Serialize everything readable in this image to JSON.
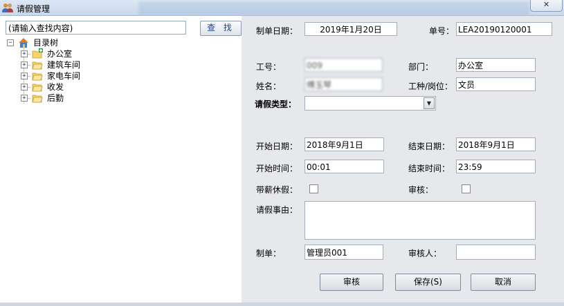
{
  "window": {
    "title": "请假管理",
    "close_label": "✕"
  },
  "search": {
    "value": "(请输入查找内容)",
    "button_label": "查 找"
  },
  "tree": {
    "root": {
      "label": "目录树",
      "icon": "home-icon"
    },
    "items": [
      {
        "label": "办公室",
        "icon": "folder-add-icon"
      },
      {
        "label": "建筑车间",
        "icon": "folder-icon"
      },
      {
        "label": "家电车间",
        "icon": "folder-icon"
      },
      {
        "label": "收发",
        "icon": "folder-icon"
      },
      {
        "label": "后勤",
        "icon": "folder-icon"
      }
    ]
  },
  "form": {
    "created_date": {
      "label": "制单日期：",
      "value": "2019年1月20日"
    },
    "doc_no": {
      "label": "单号：",
      "value": "LEA20190120001"
    },
    "emp_no": {
      "label": "工号：",
      "value": "009"
    },
    "dept": {
      "label": "部门：",
      "value": "办公室"
    },
    "name": {
      "label": "姓名：",
      "value": "傅玉琴"
    },
    "position": {
      "label": "工种/岗位：",
      "value": "文员"
    },
    "leave_type": {
      "label": "请假类型：",
      "value": ""
    },
    "start_date": {
      "label": "开始日期：",
      "value": "2018年9月1日"
    },
    "end_date": {
      "label": "结束日期：",
      "value": "2018年9月1日"
    },
    "start_time": {
      "label": "开始时间：",
      "value": "00:01"
    },
    "end_time": {
      "label": "结束时间：",
      "value": "23:59"
    },
    "paid_leave": {
      "label": "带薪休假：",
      "checked": false
    },
    "approved": {
      "label": "审核：",
      "checked": false
    },
    "reason": {
      "label": "请假事由：",
      "value": ""
    },
    "maker": {
      "label": "制单：",
      "value": "管理员001"
    },
    "approver": {
      "label": "审核人：",
      "value": ""
    }
  },
  "buttons": {
    "approve": "审核",
    "save": "保存(S)",
    "cancel": "取消"
  }
}
